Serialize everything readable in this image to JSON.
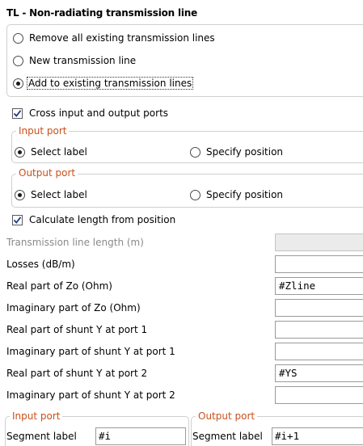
{
  "dialog": {
    "title": "TL - Non-radiating transmission line",
    "mode_options": [
      {
        "label": "Remove all existing transmission lines",
        "checked": false
      },
      {
        "label": "New transmission line",
        "checked": false
      },
      {
        "label": "Add to existing transmission lines",
        "checked": true
      }
    ],
    "cross_ports": {
      "label": "Cross input and output ports",
      "checked": true
    },
    "input_port": {
      "legend": "Input port",
      "options": [
        {
          "label": "Select label",
          "checked": true
        },
        {
          "label": "Specify position",
          "checked": false
        }
      ]
    },
    "output_port": {
      "legend": "Output port",
      "options": [
        {
          "label": "Select label",
          "checked": true
        },
        {
          "label": "Specify position",
          "checked": false
        }
      ]
    },
    "calc_length": {
      "label": "Calculate length from position",
      "checked": true
    },
    "fields": [
      {
        "label": "Transmission line length (m)",
        "value": "",
        "disabled": true
      },
      {
        "label": "Losses (dB/m)",
        "value": "",
        "disabled": false
      },
      {
        "label": "Real part of Zo (Ohm)",
        "value": "#Zline",
        "disabled": false
      },
      {
        "label": "Imaginary part of Zo (Ohm)",
        "value": "",
        "disabled": false
      },
      {
        "label": "Real part of shunt Y at port 1",
        "value": "",
        "disabled": false
      },
      {
        "label": "Imaginary part of shunt Y at port 1",
        "value": "",
        "disabled": false
      },
      {
        "label": "Real part of shunt Y at port 2",
        "value": "#YS",
        "disabled": false
      },
      {
        "label": "Imaginary part of shunt Y at port 2",
        "value": "",
        "disabled": false
      }
    ],
    "bottom_input_port": {
      "legend": "Input port",
      "segment_label": "Segment label",
      "value": "#i"
    },
    "bottom_output_port": {
      "legend": "Output port",
      "segment_label": "Segment label",
      "value": "#i+1"
    }
  }
}
